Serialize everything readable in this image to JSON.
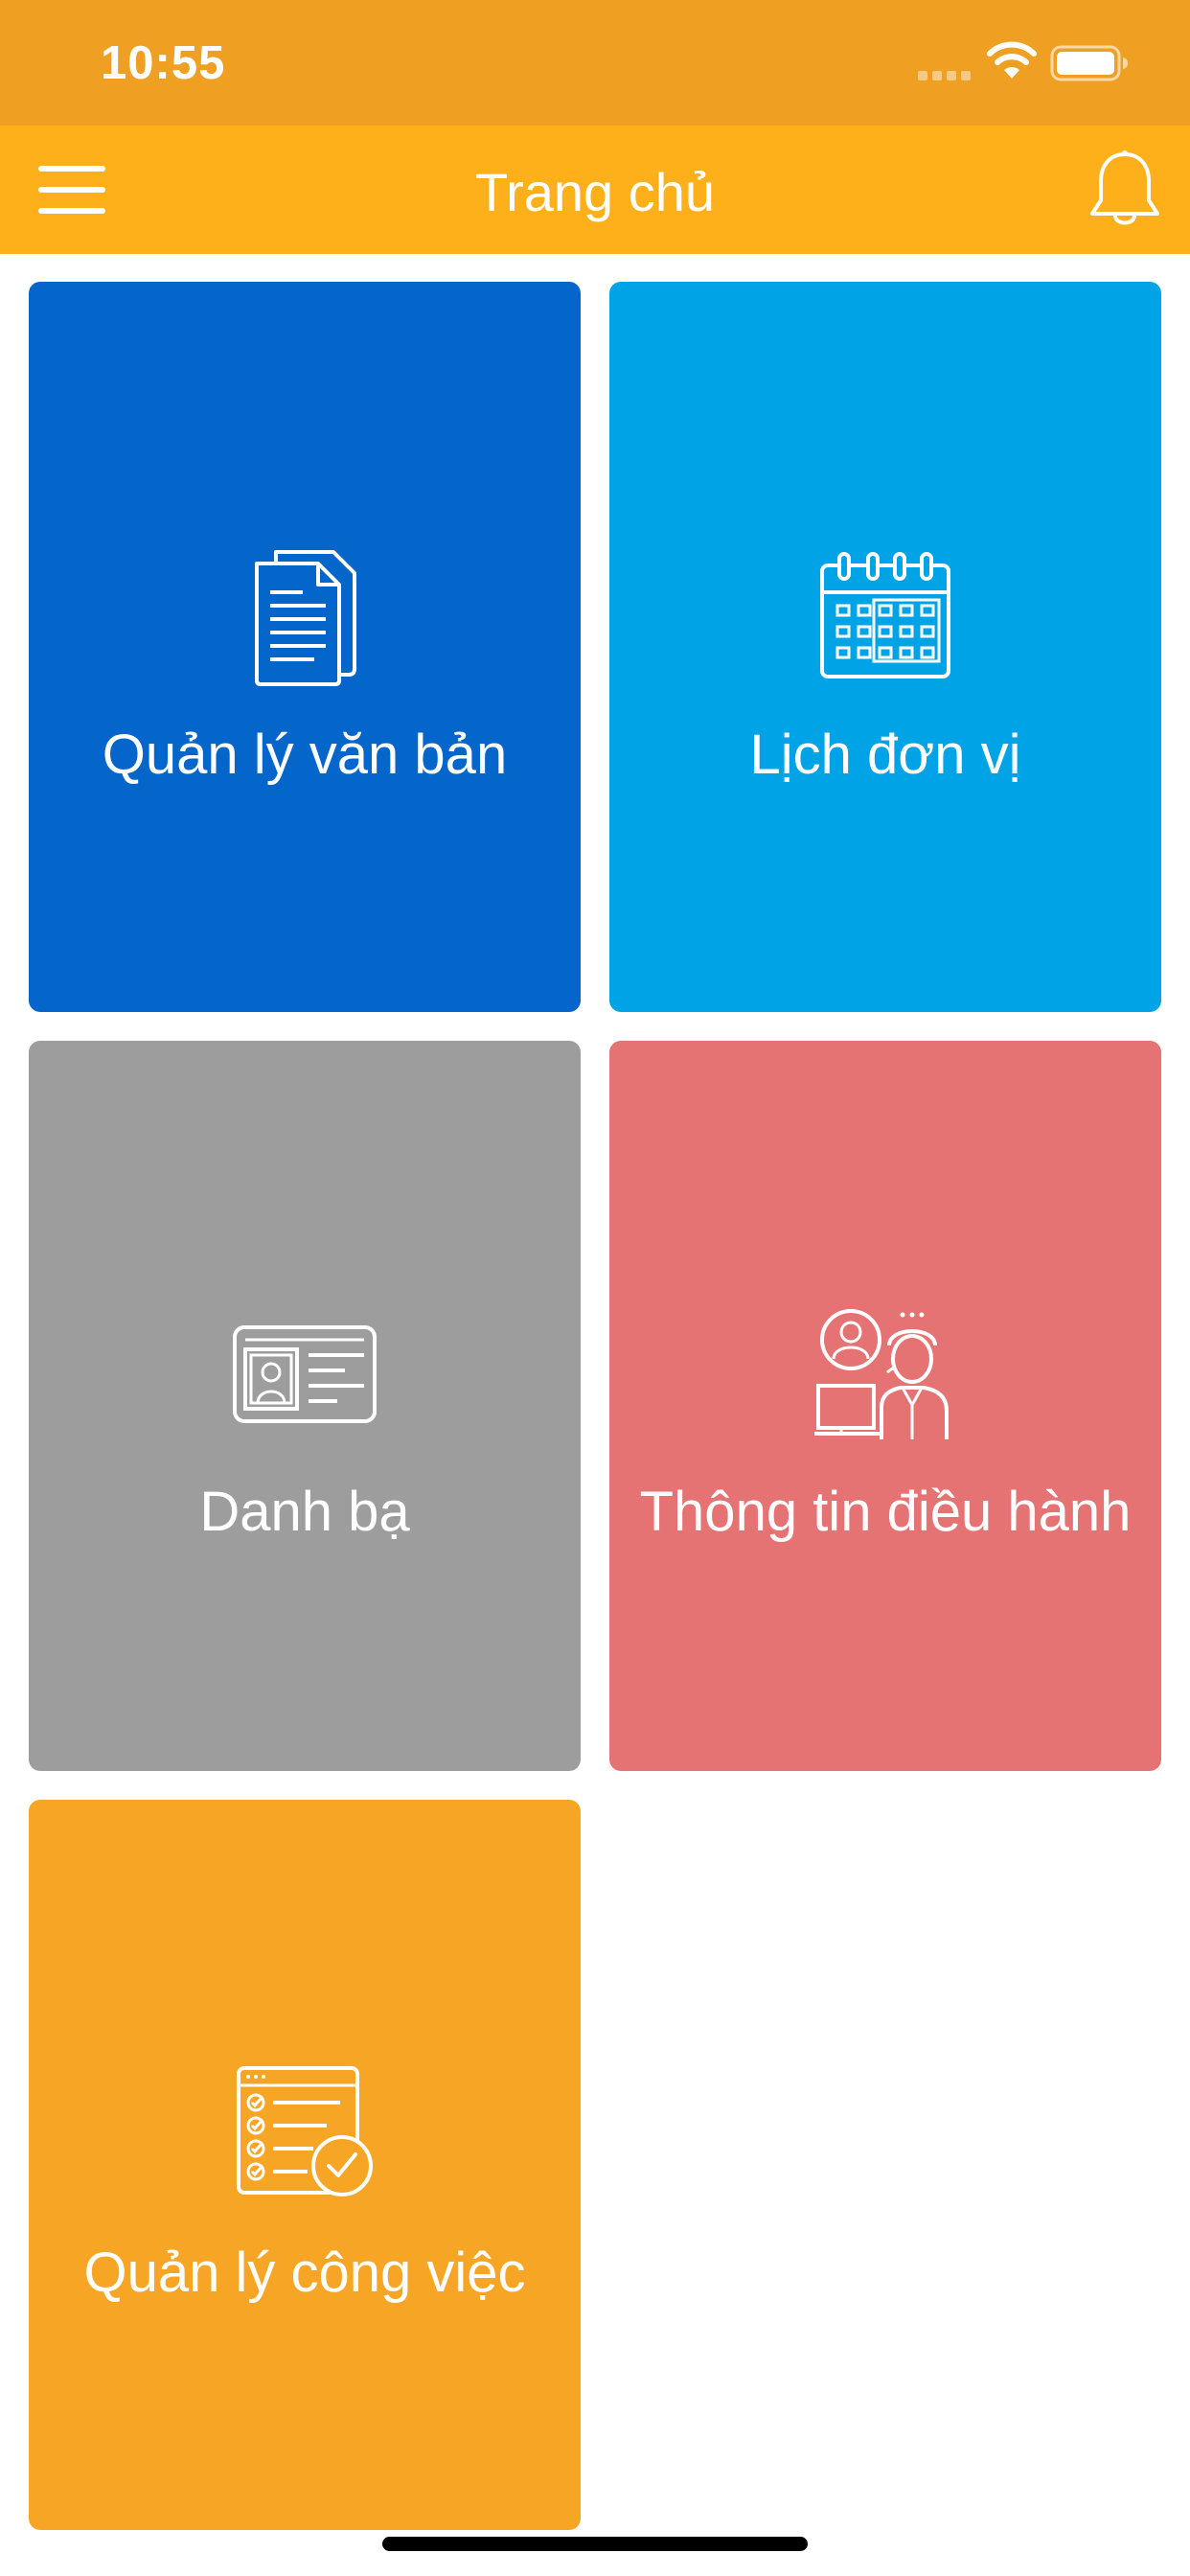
{
  "status_bar": {
    "time": "10:55",
    "signal_icon": "cellular-signal-icon",
    "wifi_icon": "wifi-icon",
    "battery_icon": "battery-icon",
    "background_color": "#EF9F22"
  },
  "nav_bar": {
    "title": "Trang chủ",
    "menu_icon": "hamburger-menu-icon",
    "bell_icon": "bell-icon",
    "background_color": "#FDB019"
  },
  "tiles": [
    {
      "label": "Quản lý văn bản",
      "icon": "documents-icon",
      "color": "#0465CB"
    },
    {
      "label": "Lịch đơn vị",
      "icon": "calendar-icon",
      "color": "#00A3E5"
    },
    {
      "label": "Danh bạ",
      "icon": "contact-card-icon",
      "color": "#9D9D9D"
    },
    {
      "label": "Thông tin điều hành",
      "icon": "operator-support-icon",
      "color": "#E67374"
    },
    {
      "label": "Quản lý công việc",
      "icon": "task-checklist-icon",
      "color": "#F6A624"
    }
  ]
}
